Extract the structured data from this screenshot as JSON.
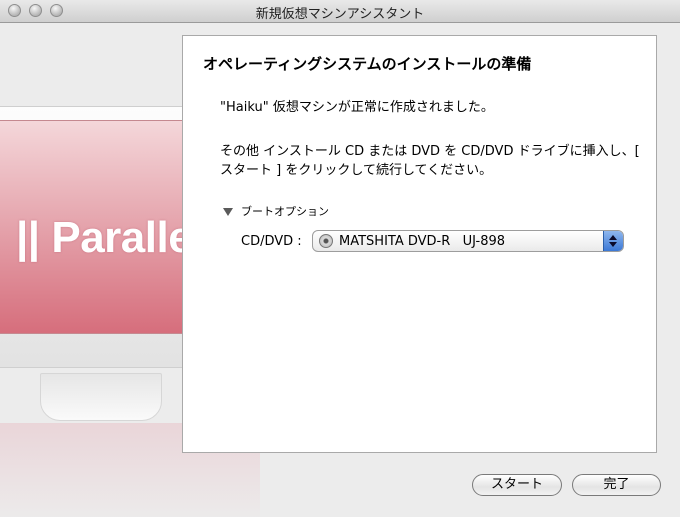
{
  "window": {
    "title": "新規仮想マシンアシスタント"
  },
  "illustration": {
    "logo_text": "|| Parallels™"
  },
  "panel": {
    "heading": "オペレーティングシステムのインストールの準備",
    "message_created": "\"Haiku\" 仮想マシンが正常に作成されました。",
    "message_instruction": "その他 インストール CD または DVD を CD/DVD ドライブに挿入し、[ スタート ] をクリックして続行してください。",
    "boot_options_label": "ブートオプション",
    "cd_dvd_label": "CD/DVD :",
    "cd_dvd_selected": "MATSHITA DVD-R   UJ-898"
  },
  "buttons": {
    "start": "スタート",
    "done": "完了"
  },
  "colors": {
    "window_bg": "#ececec",
    "panel_bg": "#ffffff",
    "select_accent": "#3b78d6",
    "logo_pink": "#d66e7c"
  }
}
